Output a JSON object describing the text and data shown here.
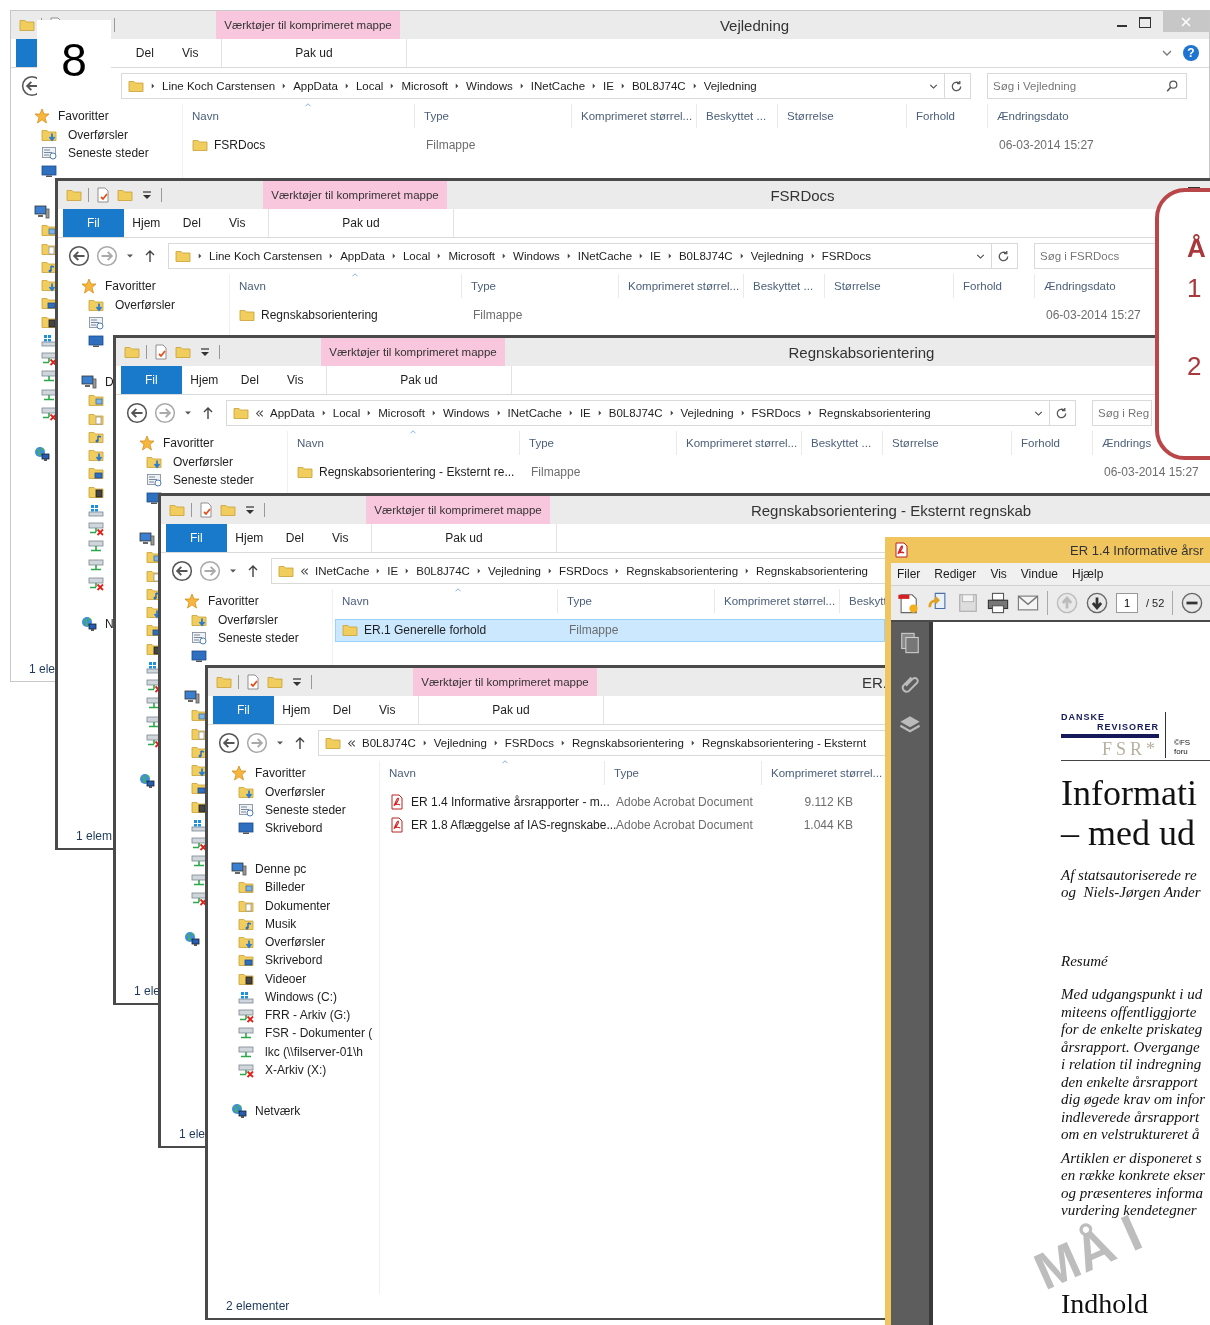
{
  "desktop_label": "8",
  "explorer_windows": [
    {
      "title": "Vejledning",
      "context_tab": "Værktøjer til komprimeret mappe",
      "help": "?",
      "ribbon_tabs": [
        {
          "kind": "file"
        },
        {
          "kind": "tab"
        },
        {
          "kind": "tab",
          "label": "Del"
        },
        {
          "kind": "tab",
          "label": "Vis"
        }
      ],
      "context_ribbon_tab": "Pak ud",
      "path_overflow": false,
      "path": [
        "Line Koch Carstensen",
        "AppData",
        "Local",
        "Microsoft",
        "Windows",
        "INetCache",
        "IE",
        "B0L8J74C",
        "Vejledning"
      ],
      "search": {
        "placeholder": "Søg i Vejledning"
      },
      "columns": [
        "Navn",
        "Type",
        "Komprimeret størrel...",
        "Beskyttet ...",
        "Størrelse",
        "Forhold",
        "Ændringsdato"
      ],
      "rows": [
        {
          "kind": "folder",
          "selected": false,
          "cells": [
            "FSRDocs",
            "Filmappe",
            null,
            null,
            null,
            null,
            "06-03-2014 15:27"
          ]
        }
      ],
      "nav": [
        {
          "kind": "star",
          "label": "Favoritter",
          "children": [
            {
              "kind": "download",
              "label": "Overførsler"
            },
            {
              "kind": "recent",
              "label": "Seneste steder"
            },
            {
              "kind": "desktop"
            }
          ]
        },
        {
          "kind": "computer",
          "children": [
            {
              "kind": "pictures"
            },
            {
              "kind": "documents"
            },
            {
              "kind": "music"
            },
            {
              "kind": "download"
            },
            {
              "kind": "desktop-folder"
            },
            {
              "kind": "videos"
            },
            {
              "kind": "drive-windows"
            },
            {
              "kind": "netdrive-off"
            },
            {
              "kind": "netdrive"
            },
            {
              "kind": "netdrive"
            },
            {
              "kind": "netdrive-off"
            }
          ]
        },
        {
          "kind": "network"
        }
      ],
      "status": "1 ele"
    },
    {
      "title": "FSRDocs",
      "context_tab": "Værktøjer til komprimeret mappe",
      "ribbon_tabs": [
        {
          "kind": "file",
          "label": "Fil"
        },
        {
          "kind": "tab",
          "label": "Hjem"
        },
        {
          "kind": "tab",
          "label": "Del"
        },
        {
          "kind": "tab",
          "label": "Vis"
        }
      ],
      "context_ribbon_tab": "Pak ud",
      "path_overflow": false,
      "path": [
        "Line Koch Carstensen",
        "AppData",
        "Local",
        "Microsoft",
        "Windows",
        "INetCache",
        "IE",
        "B0L8J74C",
        "Vejledning",
        "FSRDocs"
      ],
      "search": {
        "placeholder": "Søg i FSRDocs"
      },
      "columns": [
        "Navn",
        "Type",
        "Komprimeret størrel...",
        "Beskyttet ...",
        "Størrelse",
        "Forhold",
        "Ændringsdato"
      ],
      "rows": [
        {
          "kind": "folder",
          "selected": false,
          "cells": [
            "Regnskabsorientering",
            "Filmappe",
            null,
            null,
            null,
            null,
            "06-03-2014 15:27"
          ]
        }
      ],
      "nav": [
        {
          "kind": "star",
          "label": "Favoritter",
          "children": [
            {
              "kind": "download",
              "label": "Overførsler"
            },
            {
              "kind": "recent"
            },
            {
              "kind": "desktop"
            }
          ]
        },
        {
          "kind": "computer",
          "label": "D",
          "children": [
            {
              "kind": "pictures"
            },
            {
              "kind": "documents"
            },
            {
              "kind": "music"
            },
            {
              "kind": "download"
            },
            {
              "kind": "desktop-folder"
            },
            {
              "kind": "videos"
            },
            {
              "kind": "drive-windows"
            },
            {
              "kind": "netdrive-off"
            },
            {
              "kind": "netdrive"
            },
            {
              "kind": "netdrive"
            },
            {
              "kind": "netdrive-off"
            }
          ]
        },
        {
          "kind": "network",
          "label": "N"
        }
      ],
      "status": "1 elem"
    },
    {
      "title": "Regnskabsorientering",
      "context_tab": "Værktøjer til komprimeret mappe",
      "ribbon_tabs": [
        {
          "kind": "file",
          "label": "Fil"
        },
        {
          "kind": "tab",
          "label": "Hjem"
        },
        {
          "kind": "tab",
          "label": "Del"
        },
        {
          "kind": "tab",
          "label": "Vis"
        }
      ],
      "context_ribbon_tab": "Pak ud",
      "path_overflow": true,
      "path": [
        "AppData",
        "Local",
        "Microsoft",
        "Windows",
        "INetCache",
        "IE",
        "B0L8J74C",
        "Vejledning",
        "FSRDocs",
        "Regnskabsorientering"
      ],
      "search": {
        "placeholder": "Søg i Reg"
      },
      "columns": [
        "Navn",
        "Type",
        "Komprimeret størrel...",
        "Beskyttet ...",
        "Størrelse",
        "Forhold",
        "Ændrings"
      ],
      "rows": [
        {
          "kind": "folder",
          "selected": false,
          "cells": [
            "Regnskabsorientering - Eksternt re...",
            "Filmappe",
            null,
            null,
            null,
            null,
            "06-03-2014 15:27"
          ]
        }
      ],
      "nav": [
        {
          "kind": "star",
          "label": "Favoritter",
          "children": [
            {
              "kind": "download",
              "label": "Overførsler"
            },
            {
              "kind": "recent",
              "label": "Seneste steder"
            },
            {
              "kind": "desktop"
            }
          ]
        },
        {
          "kind": "computer",
          "children": [
            {
              "kind": "pictures"
            },
            {
              "kind": "documents"
            },
            {
              "kind": "music"
            },
            {
              "kind": "download"
            },
            {
              "kind": "desktop-folder"
            },
            {
              "kind": "videos"
            },
            {
              "kind": "drive-windows"
            },
            {
              "kind": "netdrive-off"
            },
            {
              "kind": "netdrive"
            },
            {
              "kind": "netdrive"
            },
            {
              "kind": "netdrive-off"
            }
          ]
        },
        {
          "kind": "network"
        }
      ],
      "status": "1 ele"
    },
    {
      "title": "Regnskabsorientering - Eksternt regnskab",
      "context_tab": "Værktøjer til komprimeret mappe",
      "ribbon_tabs": [
        {
          "kind": "file",
          "label": "Fil"
        },
        {
          "kind": "tab",
          "label": "Hjem"
        },
        {
          "kind": "tab",
          "label": "Del"
        },
        {
          "kind": "tab",
          "label": "Vis"
        }
      ],
      "context_ribbon_tab": "Pak ud",
      "path_overflow": true,
      "path": [
        "INetCache",
        "IE",
        "B0L8J74C",
        "Vejledning",
        "FSRDocs",
        "Regnskabsorientering",
        "Regnskabsorientering"
      ],
      "columns": [
        "Navn",
        "Type",
        "Komprimeret størrel...",
        "Beskytt"
      ],
      "rows": [
        {
          "kind": "folder",
          "selected": true,
          "cells": [
            "ER.1 Generelle forhold",
            "Filmappe"
          ]
        }
      ],
      "nav": [
        {
          "kind": "star",
          "label": "Favoritter",
          "children": [
            {
              "kind": "download",
              "label": "Overførsler"
            },
            {
              "kind": "recent",
              "label": "Seneste steder"
            },
            {
              "kind": "desktop"
            }
          ]
        },
        {
          "kind": "computer",
          "children": [
            {
              "kind": "pictures"
            },
            {
              "kind": "documents"
            },
            {
              "kind": "music"
            },
            {
              "kind": "download"
            },
            {
              "kind": "desktop-folder"
            },
            {
              "kind": "videos"
            },
            {
              "kind": "drive-windows"
            },
            {
              "kind": "netdrive-off"
            },
            {
              "kind": "netdrive"
            },
            {
              "kind": "netdrive"
            },
            {
              "kind": "netdrive-off"
            }
          ]
        },
        {
          "kind": "network"
        }
      ],
      "status": "1 ele"
    },
    {
      "title": "ER.",
      "context_tab": "Værktøjer til komprimeret mappe",
      "ribbon_tabs": [
        {
          "kind": "file",
          "label": "Fil"
        },
        {
          "kind": "tab",
          "label": "Hjem"
        },
        {
          "kind": "tab",
          "label": "Del"
        },
        {
          "kind": "tab",
          "label": "Vis"
        }
      ],
      "context_ribbon_tab": "Pak ud",
      "path_overflow": true,
      "path": [
        "B0L8J74C",
        "Vejledning",
        "FSRDocs",
        "Regnskabsorientering",
        "Regnskabsorientering - Eksternt"
      ],
      "columns": [
        "Navn",
        "Type",
        "Komprimeret størrel..."
      ],
      "rows": [
        {
          "kind": "pdf",
          "selected": false,
          "cells": [
            "ER 1.4 Informative årsrapporter - m...",
            "Adobe Acrobat Document",
            "9.112 KB"
          ]
        },
        {
          "kind": "pdf",
          "selected": false,
          "cells": [
            "ER 1.8 Aflæggelse af IAS-regnskabe...",
            "Adobe Acrobat Document",
            "1.044 KB"
          ]
        }
      ],
      "nav": [
        {
          "kind": "star",
          "label": "Favoritter",
          "children": [
            {
              "kind": "download",
              "label": "Overførsler"
            },
            {
              "kind": "recent",
              "label": "Seneste steder"
            },
            {
              "kind": "desktop",
              "label": "Skrivebord"
            }
          ]
        },
        {
          "kind": "computer",
          "label": "Denne pc",
          "children": [
            {
              "kind": "pictures",
              "label": "Billeder"
            },
            {
              "kind": "documents",
              "label": "Dokumenter"
            },
            {
              "kind": "music",
              "label": "Musik"
            },
            {
              "kind": "download",
              "label": "Overførsler"
            },
            {
              "kind": "desktop-folder",
              "label": "Skrivebord"
            },
            {
              "kind": "videos",
              "label": "Videoer"
            },
            {
              "kind": "drive-windows",
              "label": "Windows (C:)"
            },
            {
              "kind": "netdrive-off",
              "label": "FRR - Arkiv (G:)"
            },
            {
              "kind": "netdrive",
              "label": "FSR - Dokumenter ("
            },
            {
              "kind": "netdrive",
              "label": "lkc (\\\\filserver-01\\h"
            },
            {
              "kind": "netdrive-off",
              "label": "X-Arkiv (X:)"
            }
          ]
        },
        {
          "kind": "network",
          "label": "Netværk"
        }
      ],
      "status": "2 elementer"
    }
  ],
  "pdf_window": {
    "title": "ER 1.4 Informative årsr",
    "menu": [
      "Filer",
      "Rediger",
      "Vis",
      "Vindue",
      "Hjælp"
    ],
    "page": "1",
    "page_count": "/ 52",
    "document": {
      "logo_top": "DANSKE",
      "logo_bottom": "REVISORER",
      "logo_mark": "FSR*",
      "logo_note": [
        "©FS",
        "foru"
      ],
      "heading": [
        "Informati",
        "– med ud"
      ],
      "byline": [
        "Af statsautoriserede re",
        "og  Niels-Jørgen Ander"
      ],
      "section": "Resumé",
      "paragraphs": [
        [
          "Med udgangspunkt i ud",
          "miteens offentliggjorte",
          "for de enkelte priskateg",
          "årsrapport. Overgange",
          "i relation til indregning",
          "den enkelte årsrapport",
          "dig øgede krav om infor",
          "indleverede årsrapport",
          "om en velstruktureret å"
        ],
        [
          "Artiklen er disponeret s",
          "en række konkrete ekser",
          "og præsenteres informa",
          "vurdering kendetegner"
        ]
      ],
      "watermark": "MÅ I",
      "contents_heading": "Indhold"
    }
  },
  "callout": [
    {
      "text": "Å",
      "bold": true
    },
    {
      "text": "1",
      "bold": false
    },
    {
      "text": "2",
      "bold": false
    }
  ]
}
